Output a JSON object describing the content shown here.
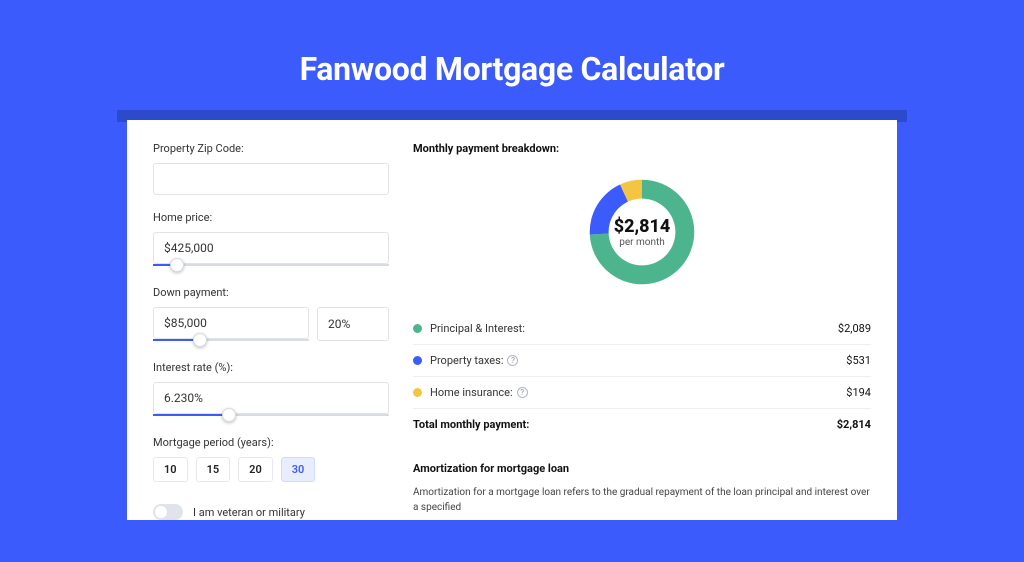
{
  "header": {
    "title": "Fanwood Mortgage Calculator"
  },
  "form": {
    "zip_label": "Property Zip Code:",
    "zip_value": "",
    "home_price_label": "Home price:",
    "home_price_value": "$425,000",
    "home_price_slider_percent": 10,
    "down_payment_label": "Down payment:",
    "down_payment_amount": "$85,000",
    "down_payment_amount_slider_percent": 30,
    "down_payment_pct": "20%",
    "interest_label": "Interest rate (%):",
    "interest_value": "6.230%",
    "interest_slider_percent": 32,
    "period_label": "Mortgage period (years):",
    "periods": [
      "10",
      "15",
      "20",
      "30"
    ],
    "period_selected_index": 3,
    "veteran_label": "I am veteran or military"
  },
  "breakdown": {
    "title": "Monthly payment breakdown:",
    "center_value": "$2,814",
    "center_subtext": "per month",
    "rows": [
      {
        "label": "Principal & Interest:",
        "value": "$2,089",
        "color": "#4cb58e",
        "info": false
      },
      {
        "label": "Property taxes:",
        "value": "$531",
        "color": "#3b5bfd",
        "info": true
      },
      {
        "label": "Home insurance:",
        "value": "$194",
        "color": "#f4c542",
        "info": true
      }
    ],
    "total_label": "Total monthly payment:",
    "total_value": "$2,814"
  },
  "chart_data": {
    "type": "pie",
    "title": "Monthly payment breakdown",
    "categories": [
      "Principal & Interest",
      "Property taxes",
      "Home insurance"
    ],
    "values": [
      2089,
      531,
      194
    ],
    "colors": [
      "#4cb58e",
      "#3b5bfd",
      "#f4c542"
    ],
    "center_label": "$2,814 per month"
  },
  "amortization": {
    "title": "Amortization for mortgage loan",
    "text": "Amortization for a mortgage loan refers to the gradual repayment of the loan principal and interest over a specified"
  }
}
